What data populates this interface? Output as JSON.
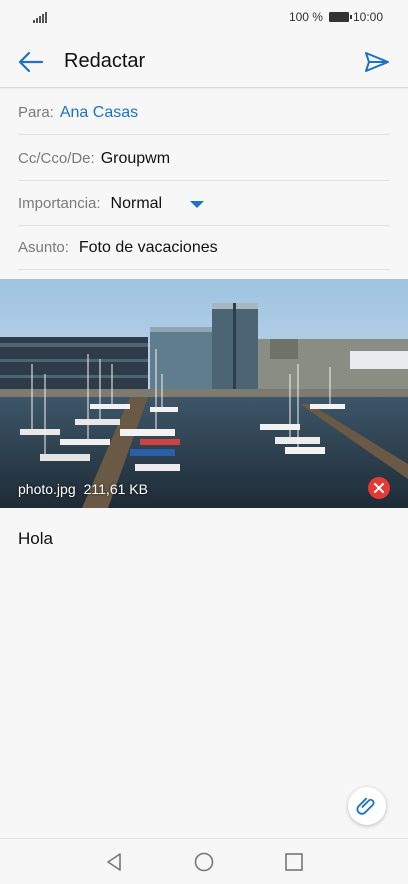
{
  "status_bar": {
    "battery_text": "100 %",
    "time": "10:00"
  },
  "app_bar": {
    "title": "Redactar"
  },
  "fields": {
    "to": {
      "label": "Para:",
      "value": "Ana Casas"
    },
    "cc": {
      "label": "Cc/Cco/De:",
      "value": "Groupwm"
    },
    "importance": {
      "label": "Importancia:",
      "value": "Normal"
    },
    "subject": {
      "label": "Asunto:",
      "value": "Foto de vacaciones"
    }
  },
  "attachment": {
    "filename": "photo.jpg",
    "size": "211,61 KB"
  },
  "body": {
    "text": "Hola"
  },
  "colors": {
    "accent": "#1a73c7",
    "remove": "#e53935"
  },
  "icons": [
    "signal-icon",
    "battery-icon",
    "back-arrow-icon",
    "send-icon",
    "dropdown-arrow-icon",
    "remove-icon",
    "paperclip-icon",
    "nav-back-icon",
    "nav-home-icon",
    "nav-recents-icon"
  ]
}
